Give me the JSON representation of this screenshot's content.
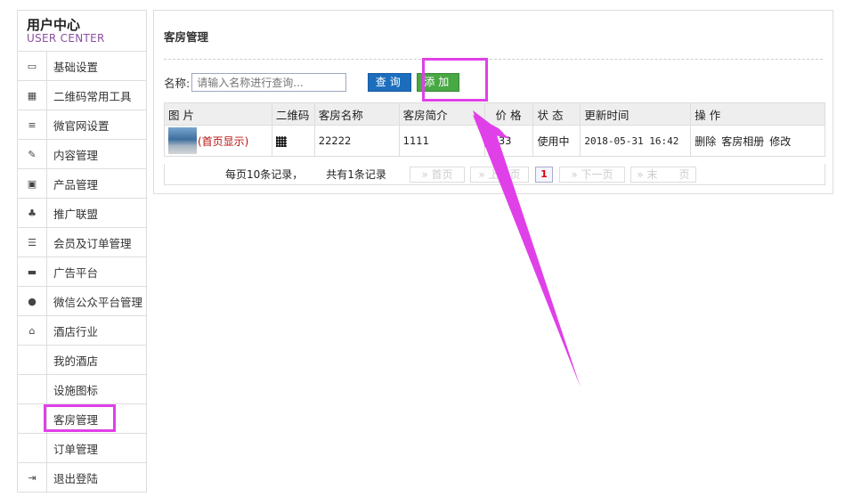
{
  "sidebar": {
    "title": "用户中心",
    "subtitle": "USER CENTER",
    "items": [
      {
        "icon": "monitor-icon",
        "glyph": "▭",
        "label": "基础设置"
      },
      {
        "icon": "qrcode-icon",
        "glyph": "▦",
        "label": "二维码常用工具"
      },
      {
        "icon": "menu-icon",
        "glyph": "≡",
        "label": "微官网设置"
      },
      {
        "icon": "edit-icon",
        "glyph": "✎",
        "label": "内容管理"
      },
      {
        "icon": "image-icon",
        "glyph": "▣",
        "label": "产品管理"
      },
      {
        "icon": "gift-icon",
        "glyph": "♣",
        "label": "推广联盟"
      },
      {
        "icon": "database-icon",
        "glyph": "☰",
        "label": "会员及订单管理"
      },
      {
        "icon": "laptop-icon",
        "glyph": "▬",
        "label": "广告平台"
      },
      {
        "icon": "chat-icon",
        "glyph": "●",
        "label": "微信公众平台管理"
      },
      {
        "icon": "home-icon",
        "glyph": "⌂",
        "label": "酒店行业"
      }
    ],
    "sub_items": [
      "我的酒店",
      "设施图标",
      "客房管理",
      "订单管理"
    ],
    "logout": {
      "icon": "logout-icon",
      "glyph": "⇥",
      "label": "退出登陆"
    }
  },
  "main": {
    "title": "客房管理",
    "search": {
      "label": "名称:",
      "placeholder": "请输入名称进行查询..."
    },
    "query_button": "查询",
    "add_button": "添加",
    "table": {
      "headers": [
        "图 片",
        "二维码",
        "客房名称",
        "客房简介",
        "价 格",
        "状 态",
        "更新时间",
        "操 作"
      ],
      "row": {
        "home_tag": "(首页显示)",
        "name": "22222",
        "intro": "1111",
        "price": "333",
        "status": "使用中",
        "updated": "2018-05-31 16:42",
        "actions": [
          "删除",
          "客房相册",
          "修改"
        ]
      }
    },
    "pager": {
      "per_page": "每页10条记录，",
      "total": "共有1条记录",
      "first": "» 首页",
      "prev": "» 上一页",
      "current": "1",
      "next": "» 下一页",
      "last": "» 末　　页"
    }
  },
  "colors": {
    "highlight": "#e040e8",
    "query_button": "#1c6ebd",
    "add_button": "#48a844"
  }
}
